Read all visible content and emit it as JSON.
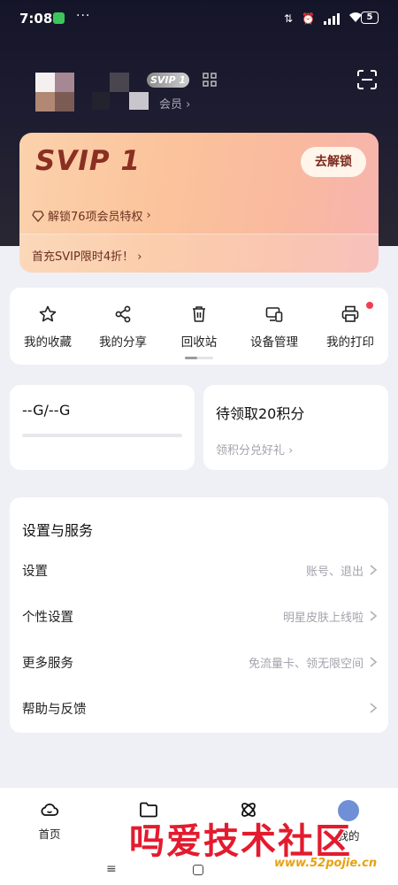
{
  "status_bar": {
    "time": "7:08",
    "dots": "···",
    "speed": "⇅",
    "battery": "5"
  },
  "profile": {
    "svip_badge": "SVIP 1",
    "member_link": "会员 ›"
  },
  "svip_card": {
    "title": "SVIP 1",
    "unlock_button": "去解锁",
    "privilege_text": "解锁76项会员特权",
    "privilege_arrow": "›",
    "promo_text": "首充SVIP限时4折！ ›"
  },
  "quick_actions": [
    {
      "label": "我的收藏",
      "icon": "star-icon"
    },
    {
      "label": "我的分享",
      "icon": "share-icon"
    },
    {
      "label": "回收站",
      "icon": "trash-icon"
    },
    {
      "label": "设备管理",
      "icon": "devices-icon"
    },
    {
      "label": "我的打印",
      "icon": "printer-icon"
    }
  ],
  "storage": {
    "text": "--G/--G"
  },
  "points": {
    "title": "待领取20积分",
    "subtitle": "领积分兑好礼 ›"
  },
  "settings": {
    "title": "设置与服务",
    "rows": [
      {
        "label": "设置",
        "hint": "账号、退出"
      },
      {
        "label": "个性设置",
        "hint": "明星皮肤上线啦"
      },
      {
        "label": "更多服务",
        "hint": "免流量卡、领无限空间"
      },
      {
        "label": "帮助与反馈",
        "hint": ""
      }
    ]
  },
  "bottom_nav": [
    {
      "label": "首页",
      "icon": "home-cloud-icon"
    },
    {
      "label": "",
      "icon": "folder-icon"
    },
    {
      "label": "",
      "icon": "discover-icon"
    },
    {
      "label": "我的",
      "icon": "avatar-icon"
    }
  ],
  "system_bar": {
    "menu": "≡"
  },
  "watermark": {
    "title": "吗爱技术社区",
    "url": "www.52pojie.cn"
  },
  "colors": {
    "accent_red": "#ef3e52",
    "card_gold": "#fbc39b",
    "text_brown": "#8a2f22"
  }
}
